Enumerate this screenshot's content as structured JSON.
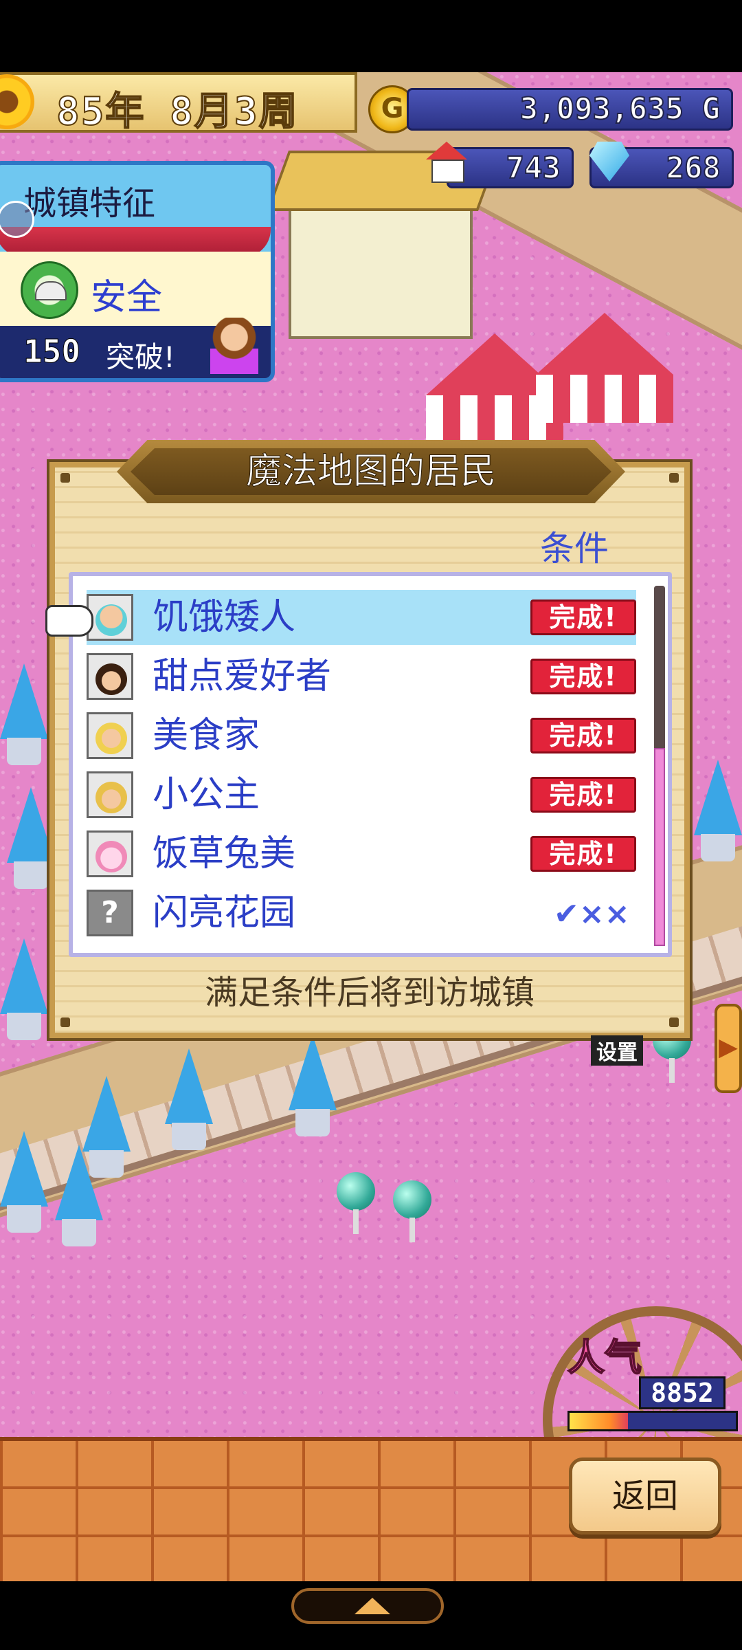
{
  "status": {
    "date_text": "85年 8月3周",
    "gold": "3,093,635 G",
    "population": "743",
    "gems": "268",
    "coin_letter": "G"
  },
  "town_feature": {
    "title": "城镇特征",
    "trait": "安全",
    "milestone_number": "150",
    "milestone_text": "突破!"
  },
  "dialog": {
    "title": "魔法地图的居民",
    "condition_header": "条件",
    "footer": "满足条件后将到访城镇",
    "residents": [
      {
        "name": "饥饿矮人",
        "status": "完成!",
        "completed": true
      },
      {
        "name": "甜点爱好者",
        "status": "完成!",
        "completed": true
      },
      {
        "name": "美食家",
        "status": "完成!",
        "completed": true
      },
      {
        "name": "小公主",
        "status": "完成!",
        "completed": true
      },
      {
        "name": "饭草兔美",
        "status": "完成!",
        "completed": true
      },
      {
        "name": "闪亮花园",
        "status": "✔××",
        "completed": false
      }
    ],
    "scroll_fraction": 0.55
  },
  "side": {
    "setting_tag": "设置"
  },
  "popularity": {
    "label": "人气",
    "value": "8852",
    "meter_fraction": 0.35
  },
  "buttons": {
    "back": "返回"
  },
  "colors": {
    "accent_blue": "#2b3ec6",
    "complete_red": "#e2233a",
    "selected_row": "#a8e1f8",
    "map_pink": "#e586c9"
  }
}
